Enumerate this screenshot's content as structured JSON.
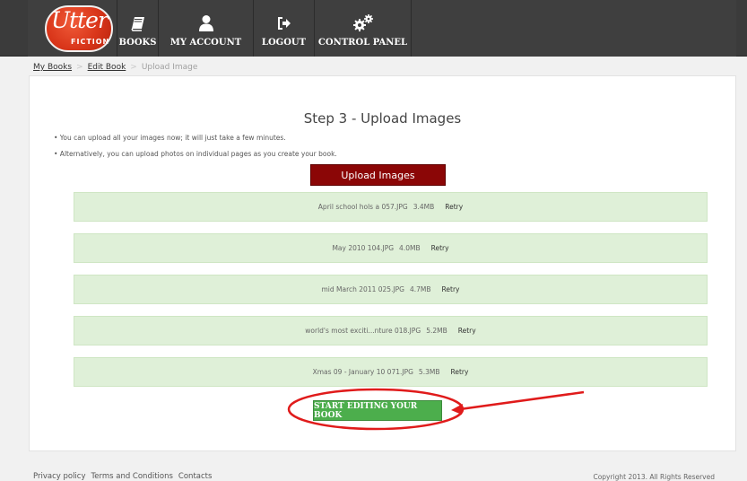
{
  "brand": {
    "logo_main": "Utter",
    "logo_sub": "FICTION"
  },
  "nav": {
    "books": "Books",
    "account": "My Account",
    "logout": "Logout",
    "control_panel": "Control Panel"
  },
  "breadcrumb": {
    "items": [
      "My Books",
      "Edit Book"
    ],
    "current": "Upload Image",
    "separator": ">"
  },
  "main": {
    "title": "Step 3 - Upload Images",
    "tips": [
      "• You can upload all your images now; it will just take a few minutes.",
      "• Alternatively, you can upload photos on individual pages as you create your book."
    ],
    "upload_label": "Upload Images",
    "files": [
      {
        "name": "April school hols a 057.JPG",
        "size": "3.4MB",
        "action": "Retry"
      },
      {
        "name": "May 2010 104.JPG",
        "size": "4.0MB",
        "action": "Retry"
      },
      {
        "name": "mid March 2011 025.JPG",
        "size": "4.7MB",
        "action": "Retry"
      },
      {
        "name": "world's most exciti...nture 018.JPG",
        "size": "5.2MB",
        "action": "Retry"
      },
      {
        "name": "Xmas 09 - January 10 071.JPG",
        "size": "5.3MB",
        "action": "Retry"
      }
    ],
    "start_label": "Start Editing Your Book"
  },
  "footer": {
    "links": [
      "Privacy policy",
      "Terms and Conditions",
      "Contacts"
    ],
    "copyright": "Copyright 2013. All Rights Reserved"
  },
  "colors": {
    "navbar": "#3f3f3f",
    "upload_button": "#8b0606",
    "start_button": "#4cae4c",
    "file_row": "#dff0d8",
    "annotation": "#e01b1b"
  }
}
